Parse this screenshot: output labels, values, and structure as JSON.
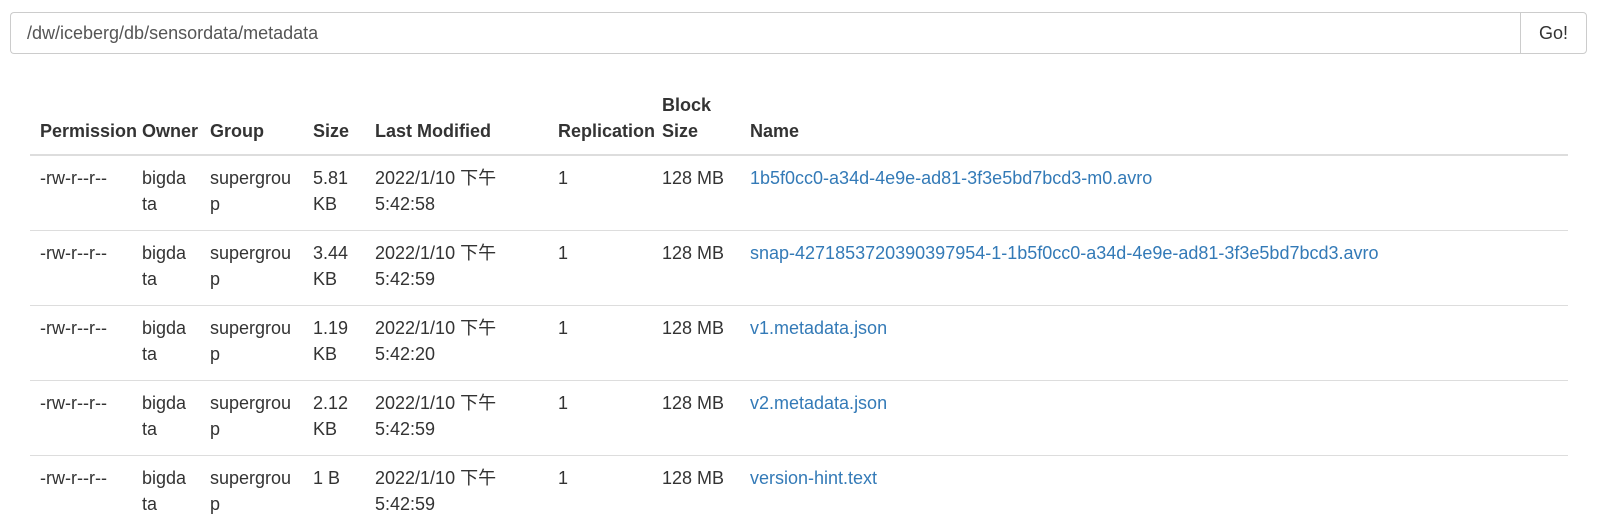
{
  "path_bar": {
    "value": "/dw/iceberg/db/sensordata/metadata",
    "go_label": "Go!"
  },
  "table": {
    "headers": {
      "permission": "Permission",
      "owner": "Owner",
      "group": "Group",
      "size": "Size",
      "last_modified": "Last Modified",
      "replication": "Replication",
      "block_size": "Block Size",
      "name": "Name"
    },
    "rows": [
      {
        "permission": "-rw-r--r--",
        "owner": "bigdata",
        "group": "supergroup",
        "size": "5.81 KB",
        "last_modified": "2022/1/10 下午5:42:58",
        "replication": "1",
        "block_size": "128 MB",
        "name": "1b5f0cc0-a34d-4e9e-ad81-3f3e5bd7bcd3-m0.avro"
      },
      {
        "permission": "-rw-r--r--",
        "owner": "bigdata",
        "group": "supergroup",
        "size": "3.44 KB",
        "last_modified": "2022/1/10 下午5:42:59",
        "replication": "1",
        "block_size": "128 MB",
        "name": "snap-4271853720390397954-1-1b5f0cc0-a34d-4e9e-ad81-3f3e5bd7bcd3.avro"
      },
      {
        "permission": "-rw-r--r--",
        "owner": "bigdata",
        "group": "supergroup",
        "size": "1.19 KB",
        "last_modified": "2022/1/10 下午5:42:20",
        "replication": "1",
        "block_size": "128 MB",
        "name": "v1.metadata.json"
      },
      {
        "permission": "-rw-r--r--",
        "owner": "bigdata",
        "group": "supergroup",
        "size": "2.12 KB",
        "last_modified": "2022/1/10 下午5:42:59",
        "replication": "1",
        "block_size": "128 MB",
        "name": "v2.metadata.json"
      },
      {
        "permission": "-rw-r--r--",
        "owner": "bigdata",
        "group": "supergroup",
        "size": "1 B",
        "last_modified": "2022/1/10 下午5:42:59",
        "replication": "1",
        "block_size": "128 MB",
        "name": "version-hint.text"
      }
    ]
  },
  "colors": {
    "link": "#337ab7",
    "text": "#333333",
    "border": "#dddddd"
  }
}
